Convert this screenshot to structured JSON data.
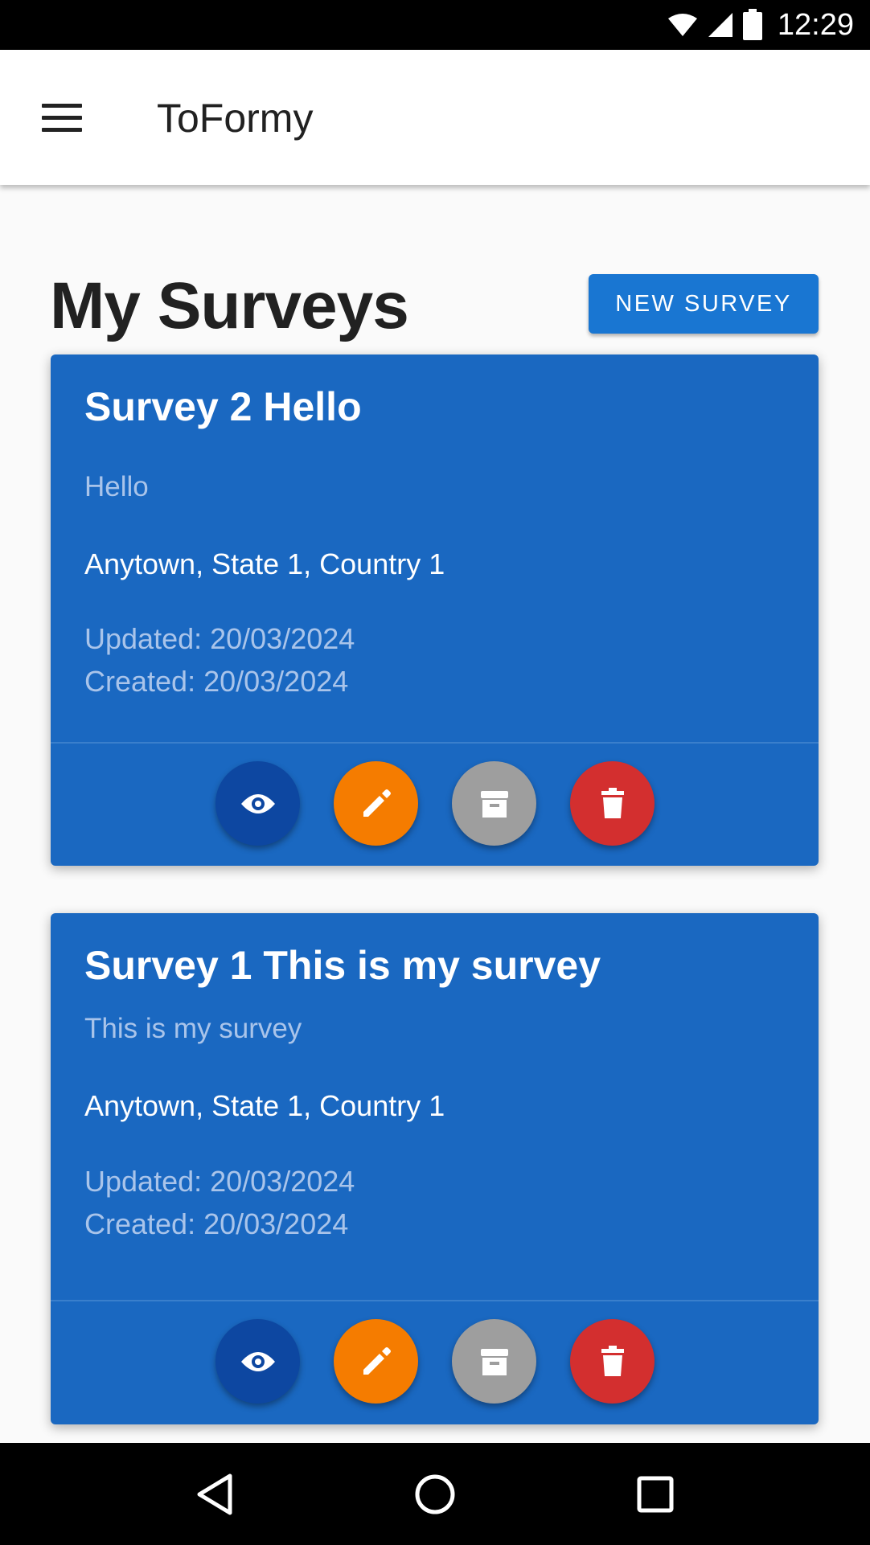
{
  "status_bar": {
    "time": "12:29",
    "icons": [
      "wifi-icon",
      "signal-icon",
      "battery-icon"
    ]
  },
  "app_bar": {
    "menu_icon": "hamburger-menu-icon",
    "title": "ToFormy"
  },
  "page": {
    "title": "My Surveys",
    "new_survey_label": "NEW SURVEY"
  },
  "surveys": [
    {
      "title": "Survey 2 Hello",
      "description": "Hello",
      "location": "Anytown, State 1, Country 1",
      "updated": "Updated: 20/03/2024",
      "created": "Created: 20/03/2024"
    },
    {
      "title": "Survey 1 This is my survey",
      "description": "This is my survey",
      "location": "Anytown, State 1, Country 1",
      "updated": "Updated: 20/03/2024",
      "created": "Created: 20/03/2024"
    }
  ],
  "card_actions": [
    "eye-icon",
    "pencil-icon",
    "archive-icon",
    "trash-icon"
  ],
  "colors": {
    "primary": "#1976d2",
    "card": "#1a68c1",
    "view": "#0d47a1",
    "edit": "#f57c00",
    "archive": "#9e9e9e",
    "delete": "#d32f2f"
  },
  "nav_bar": {
    "icons": [
      "back-icon",
      "home-icon",
      "recents-icon"
    ]
  }
}
